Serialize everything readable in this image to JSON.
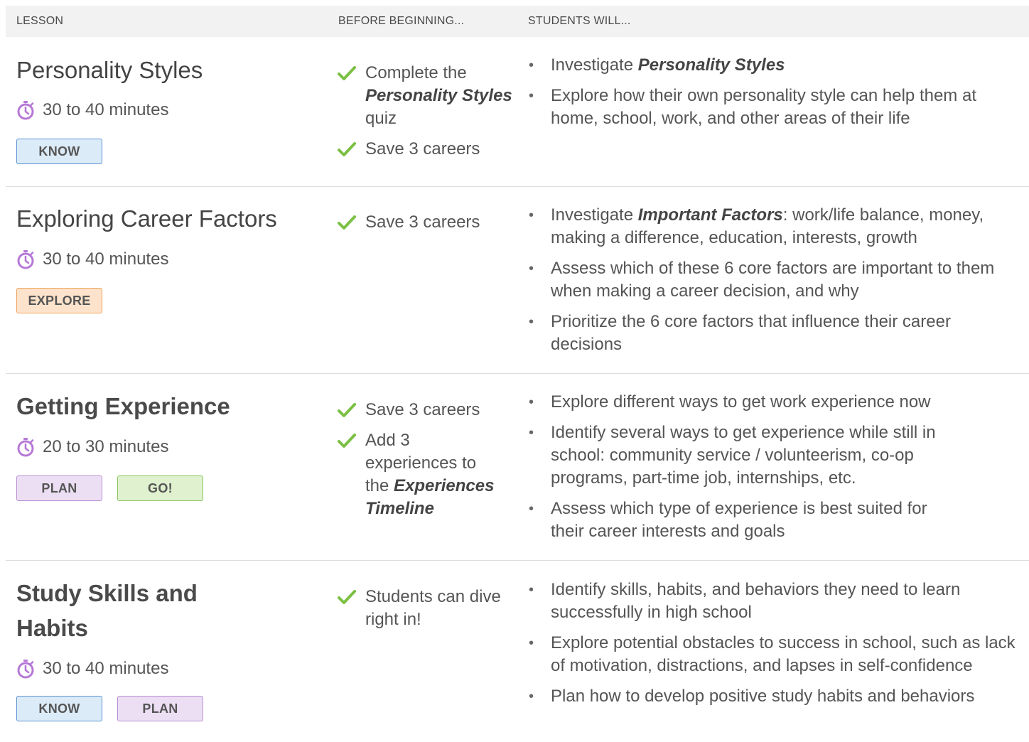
{
  "header": {
    "col_lesson": "LESSON",
    "col_before": "BEFORE BEGINNING...",
    "col_students": "STUDENTS WILL..."
  },
  "colors": {
    "check_green": "#7bc043",
    "stopwatch_purple": "#b678d6",
    "know": "#5b93d3",
    "explore": "#f1a35d",
    "plan": "#b98ed3",
    "go": "#8cc760"
  },
  "icons": {
    "time": "stopwatch-icon",
    "check": "check-icon",
    "bullet": "bullet"
  },
  "lessons": [
    {
      "title": "Personality Styles",
      "time": "30 to 40 minutes",
      "tags": [
        "KNOW"
      ],
      "before": [
        {
          "pre": "Complete the ",
          "em": "Personality Styles",
          "post": " quiz"
        },
        {
          "pre": "Save 3 careers",
          "em": "",
          "post": ""
        }
      ],
      "outcomes": [
        {
          "pre": "Investigate ",
          "em": "Personality Styles",
          "post": ""
        },
        {
          "pre": "Explore how their own personality style can help them at home, school, work, and other areas of their life",
          "em": "",
          "post": ""
        }
      ]
    },
    {
      "title": "Exploring Career Factors",
      "time": "30 to 40 minutes",
      "tags": [
        "EXPLORE"
      ],
      "before": [
        {
          "pre": "Save 3 careers",
          "em": "",
          "post": ""
        }
      ],
      "outcomes": [
        {
          "pre": "Investigate ",
          "em": "Important Factors",
          "post": ": work/life balance, money, making a difference, education, interests, growth"
        },
        {
          "pre": "Assess which of these 6 core factors are important to them when making a career decision, and why",
          "em": "",
          "post": ""
        },
        {
          "pre": "Prioritize the 6 core factors that influence their career decisions",
          "em": "",
          "post": ""
        }
      ]
    },
    {
      "title": "Getting Experience",
      "time": "20 to 30 minutes",
      "tags": [
        "PLAN",
        "GO!"
      ],
      "before": [
        {
          "pre": "Save 3 careers",
          "em": "",
          "post": ""
        },
        {
          "pre": "Add 3 experiences to the ",
          "em": "Experiences Timeline",
          "post": ""
        }
      ],
      "outcomes": [
        {
          "pre": "Explore different ways to get work experience now",
          "em": "",
          "post": ""
        },
        {
          "pre": "Identify several ways to get experience while still in school: community service / volunteerism, co-op programs, part-time job, internships, etc.",
          "em": "",
          "post": ""
        },
        {
          "pre": "Assess which type of experience is best suited for their career interests and goals",
          "em": "",
          "post": ""
        }
      ]
    },
    {
      "title": "Study Skills and Habits",
      "time": "30 to 40 minutes",
      "tags": [
        "KNOW",
        "PLAN"
      ],
      "before": [
        {
          "pre": "Students can dive right in!",
          "em": "",
          "post": ""
        }
      ],
      "outcomes": [
        {
          "pre": "Identify skills, habits, and behaviors they need to learn successfully in high school",
          "em": "",
          "post": ""
        },
        {
          "pre": "Explore potential obstacles to success in school, such as lack of motivation, distractions, and lapses in self-confidence",
          "em": "",
          "post": ""
        },
        {
          "pre": "Plan how to develop positive study habits and behaviors",
          "em": "",
          "post": ""
        }
      ]
    }
  ]
}
